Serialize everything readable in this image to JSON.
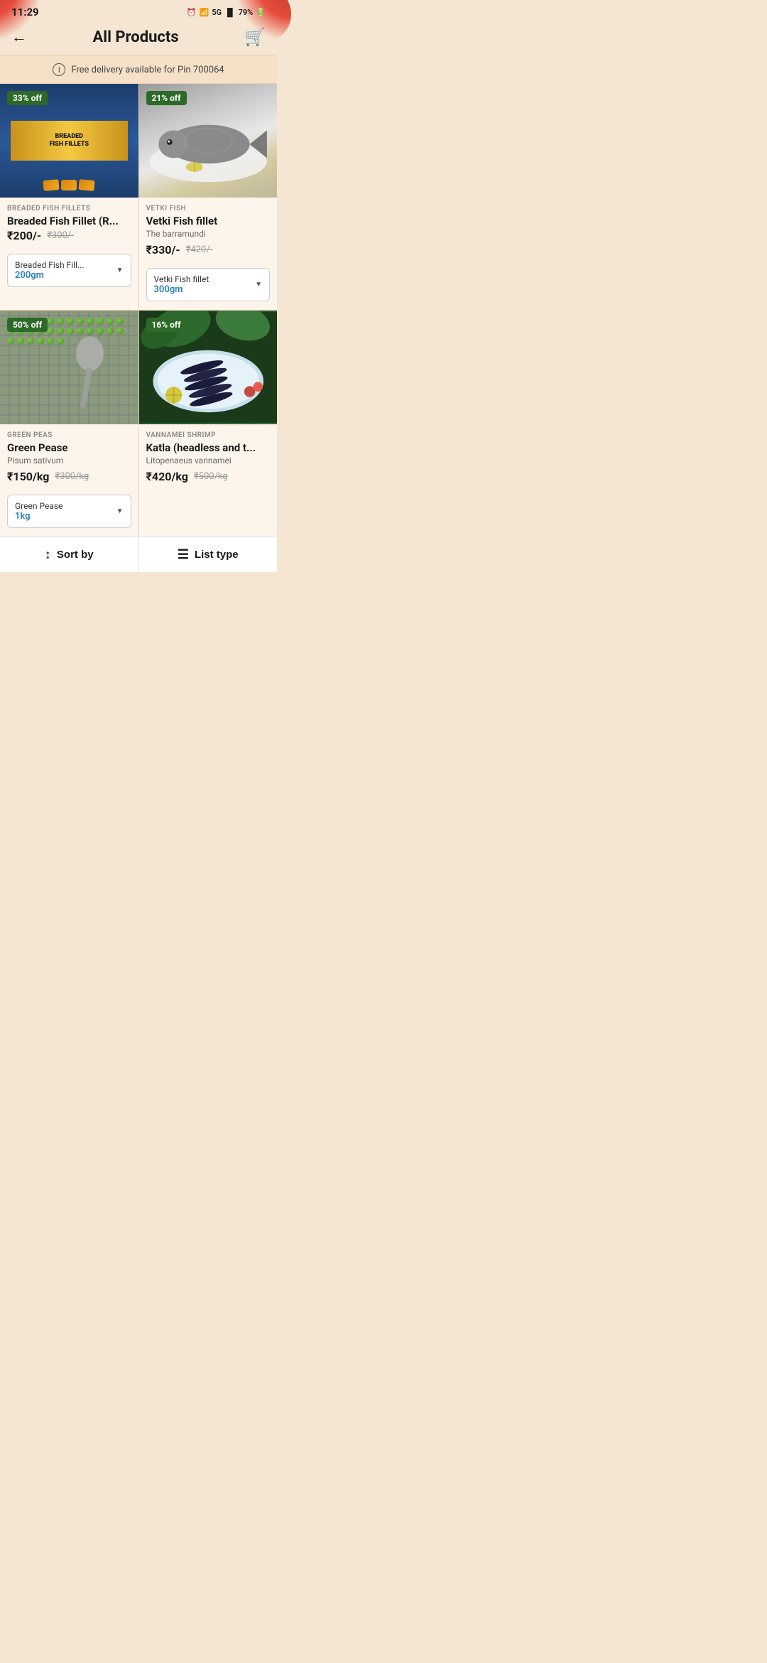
{
  "statusBar": {
    "time": "11:29",
    "battery": "79%",
    "signal": "5G"
  },
  "header": {
    "backLabel": "←",
    "title": "All Products",
    "cartIcon": "🛒"
  },
  "deliveryBanner": {
    "text": "Free delivery available for Pin 700064"
  },
  "products": [
    {
      "id": "breaded-fish-fillets",
      "category": "BREADED FISH FILLETS",
      "name": "Breaded Fish Fillet (R...",
      "subtitle": null,
      "priceCurrentDisplay": "₹200/-",
      "priceOriginalDisplay": "₹300/-",
      "discount": "33% off",
      "variantName": "Breaded Fish Fill...",
      "variantWeight": "200gm",
      "imageType": "breaded"
    },
    {
      "id": "vetki-fish",
      "category": "VETKI FISH",
      "name": "Vetki Fish fillet",
      "subtitle": "The barramundi",
      "priceCurrentDisplay": "₹330/-",
      "priceOriginalDisplay": "₹420/-",
      "discount": "21% off",
      "variantName": "Vetki Fish fillet",
      "variantWeight": "300gm",
      "imageType": "vetki"
    },
    {
      "id": "green-peas",
      "category": "GREEN PEAS",
      "name": "Green Pease",
      "subtitle": "Pisum sativum",
      "priceCurrentDisplay": "₹150/kg",
      "priceOriginalDisplay": "₹300/kg",
      "discount": "50% off",
      "variantName": "Green Pease",
      "variantWeight": "1kg",
      "imageType": "peas"
    },
    {
      "id": "vannamei-shrimp",
      "category": "VANNAMEI SHRIMP",
      "name": "Katla (headless and t...",
      "subtitle": "Litopenaeus vannamei",
      "priceCurrentDisplay": "₹420/kg",
      "priceOriginalDisplay": "₹500/kg",
      "discount": "16% off",
      "variantName": null,
      "variantWeight": null,
      "imageType": "shrimp"
    }
  ],
  "bottomBar": {
    "sortLabel": "Sort by",
    "listTypeLabel": "List type"
  }
}
